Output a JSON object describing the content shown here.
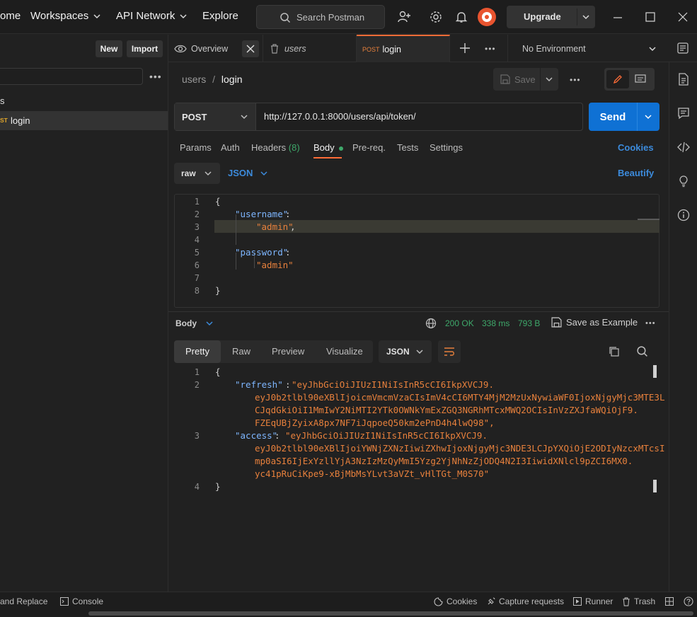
{
  "nav": {
    "home": "ome",
    "workspaces": "Workspaces",
    "api_network": "API Network",
    "explore": "Explore",
    "search_placeholder": "Search Postman",
    "upgrade": "Upgrade"
  },
  "sidebar": {
    "new_label": "New",
    "import_label": "Import",
    "section_label": "s",
    "item_method": "ST",
    "item_label": "login"
  },
  "tabs": {
    "overview": "Overview",
    "users": "users",
    "active_method": "POST",
    "active_label": "login",
    "environment": "No Environment"
  },
  "request": {
    "breadcrumb_parent": "users",
    "breadcrumb_sep": "/",
    "breadcrumb_current": "login",
    "save_label": "Save",
    "method": "POST",
    "url": "http://127.0.0.1:8000/users/api/token/",
    "send_label": "Send",
    "subtabs": [
      "Params",
      "Auth",
      "Headers",
      "Body",
      "Pre-req.",
      "Tests",
      "Settings"
    ],
    "headers_count": "(8)",
    "cookies_label": "Cookies",
    "body_mode": "raw",
    "body_format": "JSON",
    "beautify_label": "Beautify"
  },
  "request_body": {
    "line_numbers": [
      "1",
      "2",
      "3",
      "4",
      "5",
      "6",
      "7",
      "8"
    ],
    "l1": "{",
    "l2_key": "\"username\"",
    "l2_colon": ":",
    "l3_value": "\"admin\"",
    "l3_comma": ",",
    "l5_key": "\"password\"",
    "l5_colon": ":",
    "l6_value": "\"admin\"",
    "l8": "}"
  },
  "response": {
    "body_label": "Body",
    "status": "200 OK",
    "time": "338 ms",
    "size": "793 B",
    "save_example": "Save as Example",
    "view_tabs": [
      "Pretty",
      "Raw",
      "Preview",
      "Visualize"
    ],
    "format": "JSON",
    "line_numbers": [
      "1",
      "2",
      "3",
      "4"
    ],
    "l1": "{",
    "refresh_key": "\"refresh\"",
    "refresh_lines": [
      "\"eyJhbGciOiJIUzI1NiIsInR5cCI6IkpXVCJ9.",
      "eyJ0b2tlbl90eXBlIjoicmVmcmVzaCIsImV4cCI6MTY4MjM2MzUxNywiaWF0IjoxNjgyMjc3MTE3L",
      "CJqdGkiOiI1MmIwY2NiMTI2YTk0OWNkYmExZGQ3NGRhMTcxMWQ2OCIsInVzZXJfaWQiOjF9.",
      "FZEqUBjZyixA8px7NF7iJqpoeQ50km2ePnD4h4lwQ98\","
    ],
    "access_key": "\"access\"",
    "access_lines": [
      "\"eyJhbGciOiJIUzI1NiIsInR5cCI6IkpXVCJ9.",
      "eyJ0b2tlbl90eXBlIjoiYWNjZXNzIiwiZXhwIjoxNjgyMjc3NDE3LCJpYXQiOjE2ODIyNzcxMTcsI",
      "mp0aSI6IjExYzllYjA3NzIzMzQyMmI5Yzg2YjNhNzZjODQ4N2I3IiwidXNlcl9pZCI6MX0.",
      "yc41pRuCiKpe9-xBjMbMsYLvt3aVZt_vHlTGt_M0S70\""
    ],
    "l4": "}"
  },
  "statusbar": {
    "find_replace": "and Replace",
    "console": "Console",
    "cookies": "Cookies",
    "capture": "Capture requests",
    "runner": "Runner",
    "trash": "Trash"
  },
  "colors": {
    "accent_orange": "#ff6c37",
    "send_blue": "#0f71d4",
    "link_blue": "#3c8bdc",
    "status_green": "#3ea86a"
  }
}
